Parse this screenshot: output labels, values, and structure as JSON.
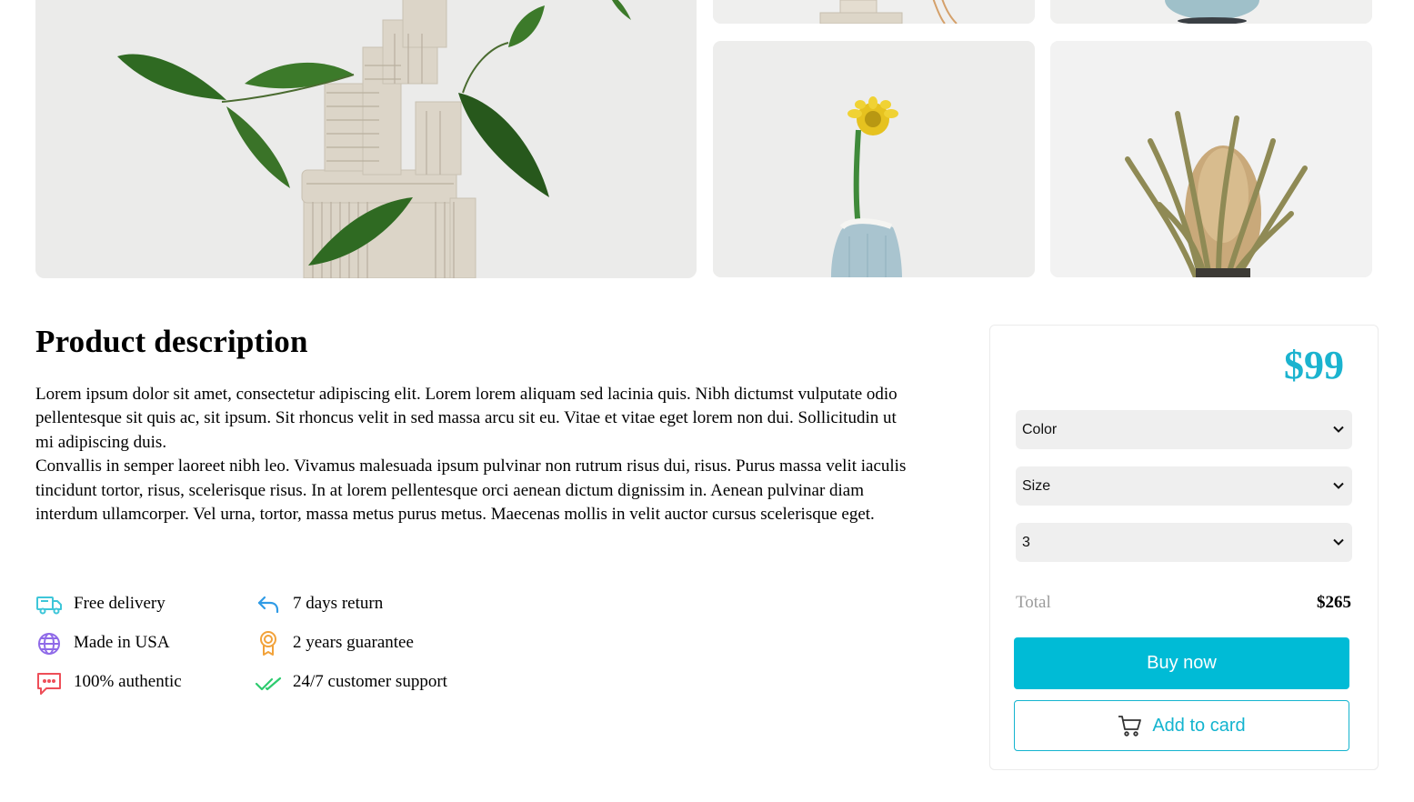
{
  "gallery": {
    "images": [
      {
        "alt": "clay sculpture with green leaves"
      },
      {
        "alt": "clay sculpture detail"
      },
      {
        "alt": "blue ceramic detail"
      },
      {
        "alt": "yellow flower in blue vase"
      },
      {
        "alt": "dried banksia flower"
      }
    ]
  },
  "description": {
    "title": "Product description",
    "paragraphs": [
      "Lorem ipsum dolor sit amet, consectetur adipiscing elit. Lorem lorem aliquam sed lacinia quis. Nibh dictumst vulputate odio pellentesque sit quis ac, sit ipsum. Sit rhoncus velit in sed massa arcu sit eu. Vitae et vitae eget lorem non dui. Sollicitudin ut mi adipiscing duis.",
      "Convallis in semper laoreet nibh leo. Vivamus malesuada ipsum pulvinar non rutrum risus dui, risus. Purus massa velit iaculis tincidunt tortor, risus, scelerisque risus. In at lorem pellentesque orci aenean dictum dignissim in. Aenean pulvinar diam interdum ullamcorper. Vel urna, tortor, massa metus purus metus. Maecenas mollis in velit auctor cursus scelerisque eget."
    ]
  },
  "features": [
    {
      "label": "Free delivery",
      "icon": "truck-icon",
      "color": "#3ec6d9"
    },
    {
      "label": "7 days return",
      "icon": "return-arrow-icon",
      "color": "#2f9be6"
    },
    {
      "label": "Made in USA",
      "icon": "globe-icon",
      "color": "#8f6ae8"
    },
    {
      "label": "2 years guarantee",
      "icon": "award-icon",
      "color": "#f2a23a"
    },
    {
      "label": "100% authentic",
      "icon": "chat-icon",
      "color": "#ee4e58"
    },
    {
      "label": "24/7 customer support",
      "icon": "double-check-icon",
      "color": "#2ecb6f"
    }
  ],
  "panel": {
    "price": "$99",
    "accent_color": "#00bbd6",
    "selects": {
      "color": "Color",
      "size": "Size",
      "quantity": "3"
    },
    "total_label": "Total",
    "total_value": "$265",
    "buy_now": "Buy now",
    "add_to_cart": "Add to card"
  }
}
